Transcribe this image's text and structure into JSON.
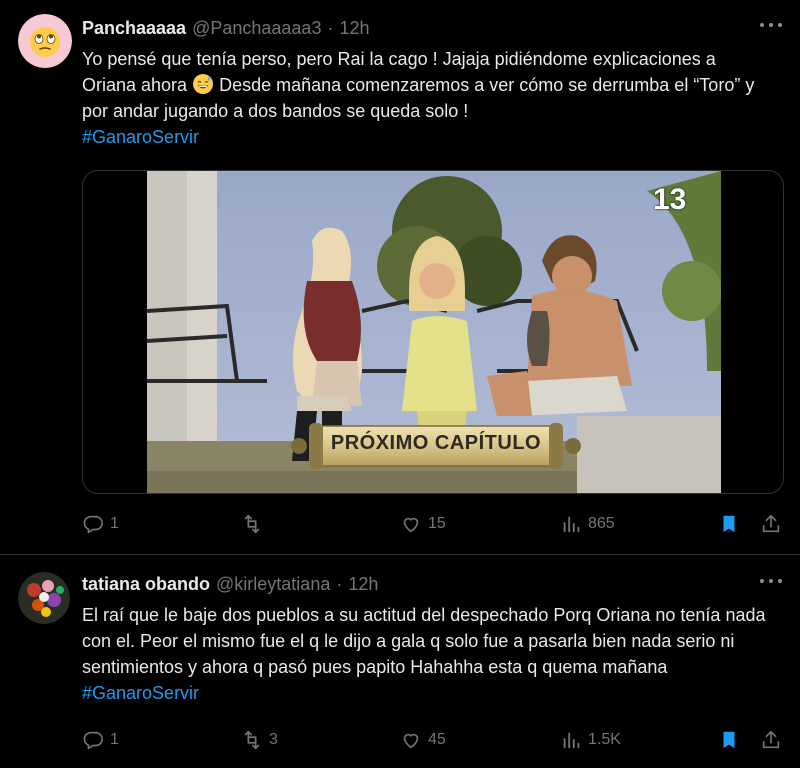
{
  "tweets": [
    {
      "name": "Panchaaaaa",
      "handle": "@Panchaaaaa3",
      "dot": "·",
      "time": "12h",
      "text_part1": "Yo pensé que tenía perso, pero Rai la cago ! Jajaja pidiéndome explicaciones a Oriana ahora",
      "text_part2": " Desde mañana comenzaremos a ver cómo se derrumba el “Toro” y por andar jugando a dos bandos se queda solo !",
      "hashtag": "#GanaroServir",
      "media_banner": "PRÓXIMO CAPÍTULO",
      "media_logo": "13",
      "replies": "1",
      "retweets": "",
      "likes": "15",
      "views": "865"
    },
    {
      "name": "tatiana obando",
      "handle": "@kirleytatiana",
      "dot": "·",
      "time": "12h",
      "text": "El raí que le baje dos pueblos a su actitud del despechado Porq Oriana no tenía nada con el. Peor el mismo fue el q le dijo a gala q solo fue a pasarla bien nada serio ni sentimientos y ahora q pasó pues papito Hahahha esta q quema mañana ",
      "hashtag": "#GanaroServir",
      "replies": "1",
      "retweets": "3",
      "likes": "45",
      "views": "1.5K"
    }
  ],
  "colors": {
    "background": "#000000",
    "text": "#e7e9ea",
    "muted": "#71767b",
    "accent": "#1d9bf0",
    "bookmark": "#1d9bf0",
    "divider": "#2f3336"
  },
  "icons": [
    "reply-icon",
    "retweet-icon",
    "like-icon",
    "views-icon",
    "bookmark-icon",
    "share-icon",
    "more-icon",
    "emoji-rolling-eyes",
    "emoji-sweat-smile"
  ]
}
